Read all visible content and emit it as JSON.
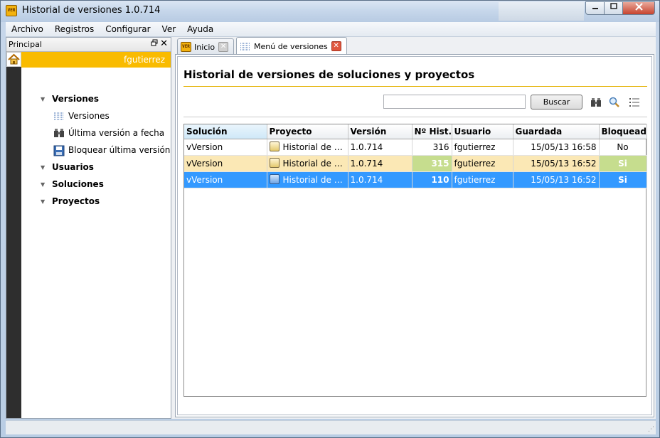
{
  "window": {
    "title": "Historial de versiones 1.0.714",
    "app_icon_text": "VER"
  },
  "menu": [
    "Archivo",
    "Registros",
    "Configurar",
    "Ver",
    "Ayuda"
  ],
  "left_panel": {
    "title": "Principal",
    "user": "fgutierrez",
    "tree": [
      {
        "label": "Versiones",
        "children": [
          "Versiones",
          "Última versión a fecha",
          "Bloquear última versión"
        ]
      },
      {
        "label": "Usuarios"
      },
      {
        "label": "Soluciones"
      },
      {
        "label": "Proyectos"
      }
    ]
  },
  "tabs": [
    {
      "label": "Inicio",
      "active": false
    },
    {
      "label": "Menú de versiones",
      "active": true
    }
  ],
  "content": {
    "title": "Historial de versiones de soluciones y proyectos",
    "search_value": "",
    "search_button": "Buscar"
  },
  "table": {
    "columns": [
      "Solución",
      "Proyecto",
      "Versión",
      "Nº Hist.",
      "Usuario",
      "Guardada",
      "Bloqueada"
    ],
    "rows": [
      {
        "solucion": "vVersion",
        "proyecto": "Historial de versiones",
        "version": "1.0.714",
        "hist": "316",
        "usuario": "fgutierrez",
        "guardada": "15/05/13 16:58",
        "bloqueada": "No",
        "state": "normal"
      },
      {
        "solucion": "vVersion",
        "proyecto": "Historial de versiones",
        "version": "1.0.714",
        "hist": "315",
        "usuario": "fgutierrez",
        "guardada": "15/05/13 16:52",
        "bloqueada": "Si",
        "state": "highlight"
      },
      {
        "solucion": "vVersion",
        "proyecto": "Historial de versiones",
        "version": "1.0.714",
        "hist": "110",
        "usuario": "fgutierrez",
        "guardada": "15/05/13 16:52",
        "bloqueada": "Si",
        "state": "selected"
      }
    ]
  },
  "colors": {
    "accent": "#f9bb00",
    "selection": "#3399ff",
    "highlight_row": "#fbe8b5",
    "highlight_cell": "#c6dd8e"
  }
}
